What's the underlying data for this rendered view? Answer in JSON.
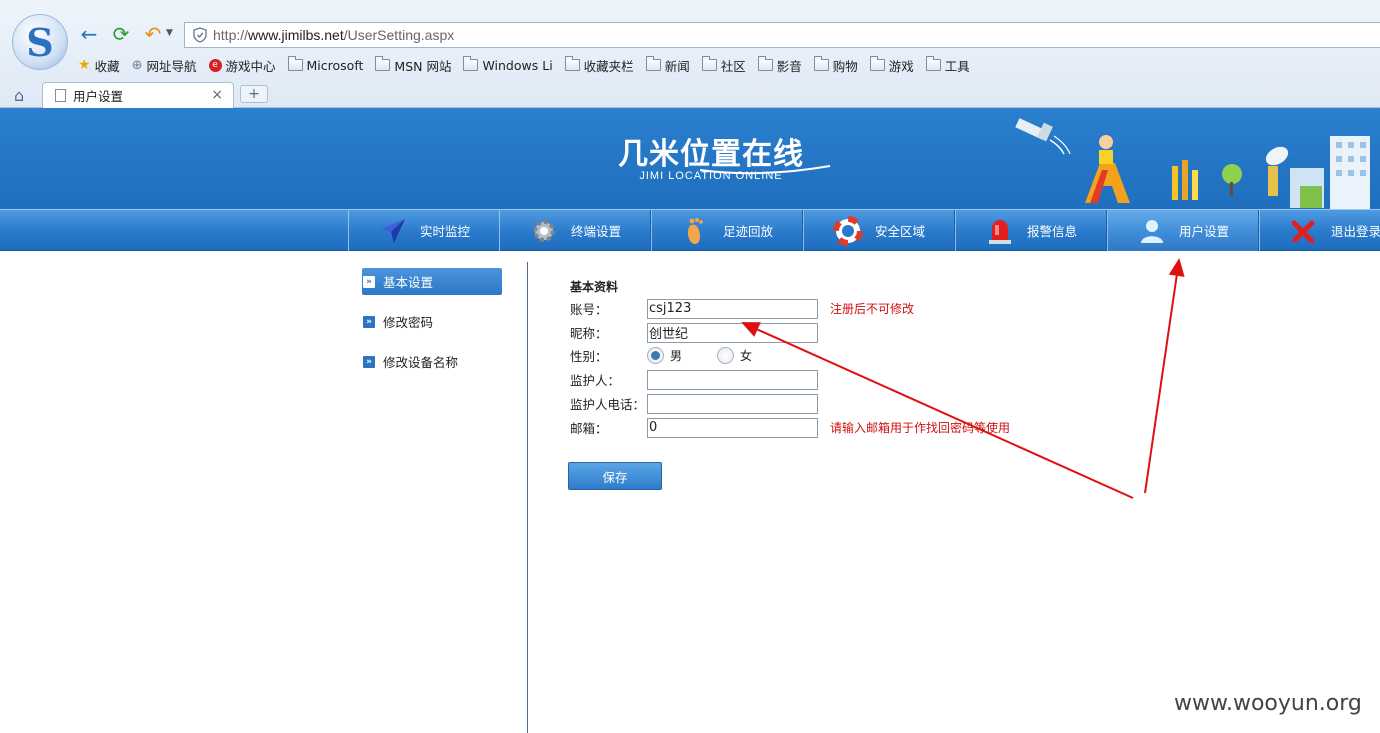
{
  "browser": {
    "url_host_prefix": "http://",
    "url_host": "www.jimilbs.net",
    "url_path": "/UserSetting.aspx",
    "bookmarks": [
      "收藏",
      "网址导航",
      "游戏中心",
      "Microsoft",
      "MSN 网站",
      "Windows Li",
      "收藏夹栏",
      "新闻",
      "社区",
      "影音",
      "购物",
      "游戏",
      "工具"
    ],
    "tab_title": "用户设置",
    "close_symbol": "×",
    "new_tab_symbol": "+"
  },
  "site": {
    "logo_cn": "几米位置在线",
    "logo_en": "JIMI LOCATION ONLINE"
  },
  "nav": {
    "items": [
      {
        "label": "实时监控",
        "icon": "paper-plane-icon"
      },
      {
        "label": "终端设置",
        "icon": "gear-icon"
      },
      {
        "label": "足迹回放",
        "icon": "footprint-icon"
      },
      {
        "label": "安全区域",
        "icon": "lifebuoy-icon"
      },
      {
        "label": "报警信息",
        "icon": "alarm-light-icon"
      },
      {
        "label": "用户设置",
        "icon": "user-icon",
        "active": true
      },
      {
        "label": "退出登录",
        "icon": "red-x-icon"
      }
    ]
  },
  "sidebar": {
    "items": [
      {
        "label": "基本设置",
        "active": true
      },
      {
        "label": "修改密码"
      },
      {
        "label": "修改设备名称"
      }
    ],
    "arrow_symbol": "»"
  },
  "form": {
    "section_title": "基本资料",
    "account": {
      "label": "账号：",
      "value": "csj123",
      "hint": "注册后不可修改"
    },
    "nickname": {
      "label": "昵称：",
      "value": "创世纪"
    },
    "gender": {
      "label": "性别：",
      "options": [
        "男",
        "女"
      ],
      "selected": "男"
    },
    "guardian": {
      "label": "监护人：",
      "value": ""
    },
    "guardian_phone": {
      "label": "监护人电话：",
      "value": ""
    },
    "email": {
      "label": "邮箱：",
      "value": "0",
      "hint": "请输入邮箱用于作找回密码等使用"
    },
    "save_label": "保存"
  },
  "watermark": "www.wooyun.org",
  "colors": {
    "header_blue": "#2a7fce",
    "annotation_red": "#e01010",
    "hint_red": "#d01010"
  }
}
